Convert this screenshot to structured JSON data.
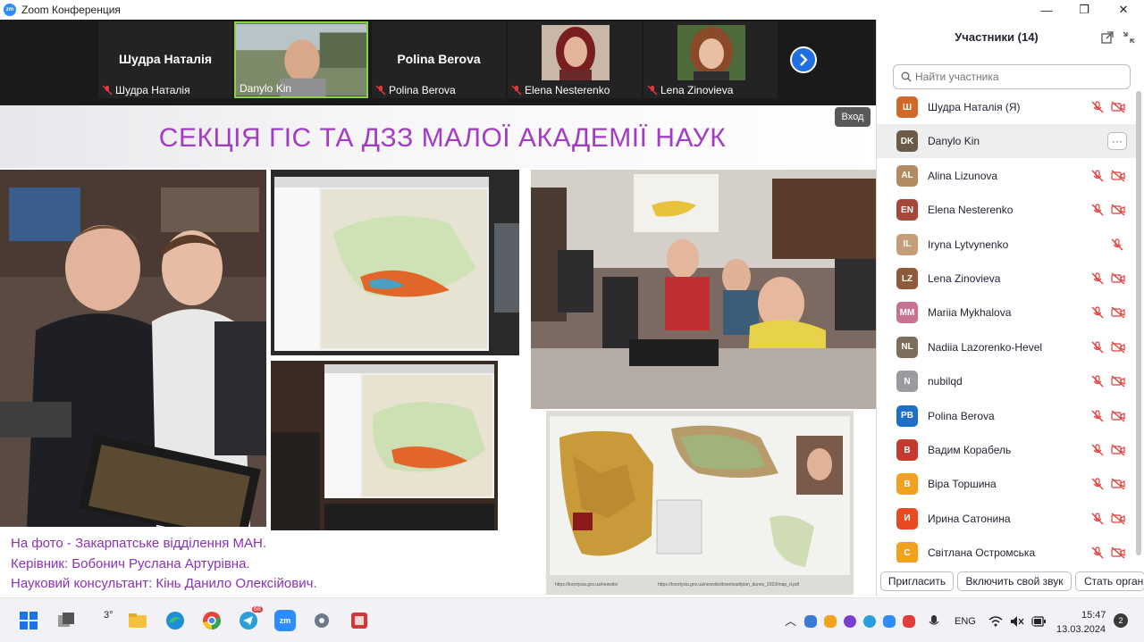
{
  "window": {
    "title": "Zoom Конференция",
    "app_badge": "zm",
    "minimize": "—",
    "maximize": "❐",
    "close": "✕"
  },
  "video_strip": {
    "tiles": [
      {
        "big_name": "Шудра Наталія",
        "label": "Шудра Наталія"
      },
      {
        "big_name": "",
        "label": "Danylo Kin"
      },
      {
        "big_name": "Polina Berova",
        "label": "Polina Berova"
      },
      {
        "big_name": "",
        "label": "Elena Nesterenko"
      },
      {
        "big_name": "",
        "label": "Lena Zinovieva"
      }
    ],
    "next_icon": "chevron-right-icon"
  },
  "slide": {
    "title": "СЕКЦІЯ ГІС ТА ДЗЗ МАЛОЇ АКАДЕМІЇ НАУК",
    "enter_button": "Вход",
    "caption": [
      "На фото - Закарпатське відділення МАН.",
      "Керівник: Бобонич Руслана Артурівна.",
      "Науковий консультант: Кінь Данило Олексійович."
    ],
    "map_link_1": "https://kosrtysia.gov.ua/newsite/",
    "map_link_2": "https://kosrtysia.gov.ua/newsite/download/plan_dunes_2023/map_d.pdf"
  },
  "panel": {
    "title": "Участники (14)",
    "search_placeholder": "Найти участника",
    "participants": [
      {
        "name": "Шудра Наталія (Я)",
        "initials": "Ш",
        "color": "#d0682a",
        "mic_muted": true,
        "cam_off": true
      },
      {
        "name": "Danylo Kin",
        "initials": "DK",
        "color": "#6b5a48",
        "selected": true
      },
      {
        "name": "Alina Lizunova",
        "initials": "AL",
        "color": "#b48a60",
        "mic_muted": true,
        "cam_off": true
      },
      {
        "name": "Elena Nesterenko",
        "initials": "EN",
        "color": "#a7463a",
        "mic_muted": true,
        "cam_off": true
      },
      {
        "name": "Iryna Lytvynenko",
        "initials": "IL",
        "color": "#c59d78",
        "mic_muted": true,
        "cam_off": false
      },
      {
        "name": "Lena Zinovieva",
        "initials": "LZ",
        "color": "#8f5a3c",
        "mic_muted": true,
        "cam_off": true
      },
      {
        "name": "Mariia Mykhalova",
        "initials": "MM",
        "color": "#c9728d",
        "mic_muted": true,
        "cam_off": true
      },
      {
        "name": "Nadiia Lazorenko-Hevel",
        "initials": "NL",
        "color": "#7d6d5d",
        "mic_muted": true,
        "cam_off": true
      },
      {
        "name": "nubilqd",
        "initials": "N",
        "color": "#9a9aa0",
        "mic_muted": true,
        "cam_off": true
      },
      {
        "name": "Polina Berova",
        "initials": "PB",
        "color": "#1f6fc5",
        "mic_muted": true,
        "cam_off": true
      },
      {
        "name": "Вадим Корабель",
        "initials": "В",
        "color": "#c43a2e",
        "mic_muted": true,
        "cam_off": true
      },
      {
        "name": "Віра Торшина",
        "initials": "В",
        "color": "#f2a11e",
        "mic_muted": true,
        "cam_off": true
      },
      {
        "name": "Ирина Сатонина",
        "initials": "И",
        "color": "#e84a22",
        "mic_muted": true,
        "cam_off": true
      },
      {
        "name": "Світлана Остромська",
        "initials": "С",
        "color": "#f2a11e",
        "mic_muted": true,
        "cam_off": true
      }
    ],
    "invite_button": "Пригласить",
    "unmute_button": "Включить свой звук",
    "more_button": "Стать органи",
    "more_label": "···"
  },
  "taskbar": {
    "weather": "3°",
    "telegram_badge": "68",
    "zoom_badge": "zm",
    "language": "ENG",
    "time": "15:47",
    "date": "13.03.2024",
    "notifications": "2"
  }
}
